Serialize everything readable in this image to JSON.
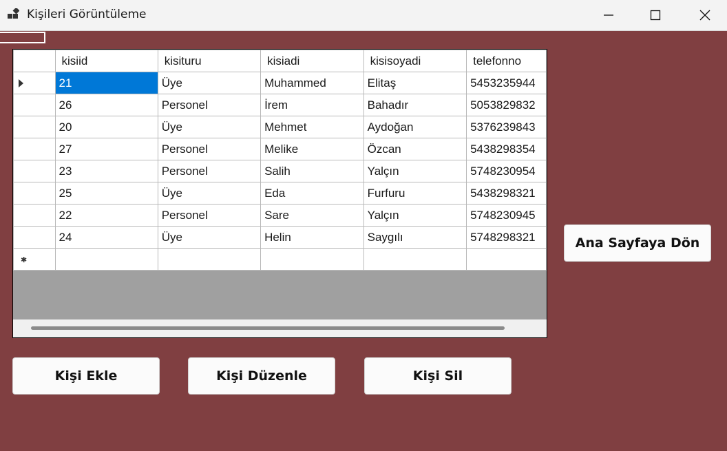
{
  "window": {
    "title": "Kişileri Görüntüleme"
  },
  "grid": {
    "columns": [
      "kisiid",
      "kisituru",
      "kisiadi",
      "kisisoyadi",
      "telefonno"
    ],
    "rows": [
      [
        "21",
        "Üye",
        "Muhammed",
        "Elitaş",
        "5453235944"
      ],
      [
        "26",
        "Personel",
        "İrem",
        "Bahadır",
        "5053829832"
      ],
      [
        "20",
        "Üye",
        "Mehmet",
        "Aydoğan",
        "5376239843"
      ],
      [
        "27",
        "Personel",
        "Melike",
        "Özcan",
        "5438298354"
      ],
      [
        "23",
        "Personel",
        "Salih",
        "Yalçın",
        "5748230954"
      ],
      [
        "25",
        "Üye",
        "Eda",
        "Furfuru",
        "5438298321"
      ],
      [
        "22",
        "Personel",
        "Sare",
        "Yalçın",
        "5748230945"
      ],
      [
        "24",
        "Üye",
        "Helin",
        "Saygılı",
        "5748298321"
      ]
    ],
    "new_row_marker": "✱"
  },
  "buttons": {
    "home": "Ana Sayfaya Dön",
    "add": "Kişi Ekle",
    "edit": "Kişi Düzenle",
    "delete": "Kişi Sil"
  },
  "colors": {
    "background": "#803f41",
    "selection": "#0078d7"
  }
}
